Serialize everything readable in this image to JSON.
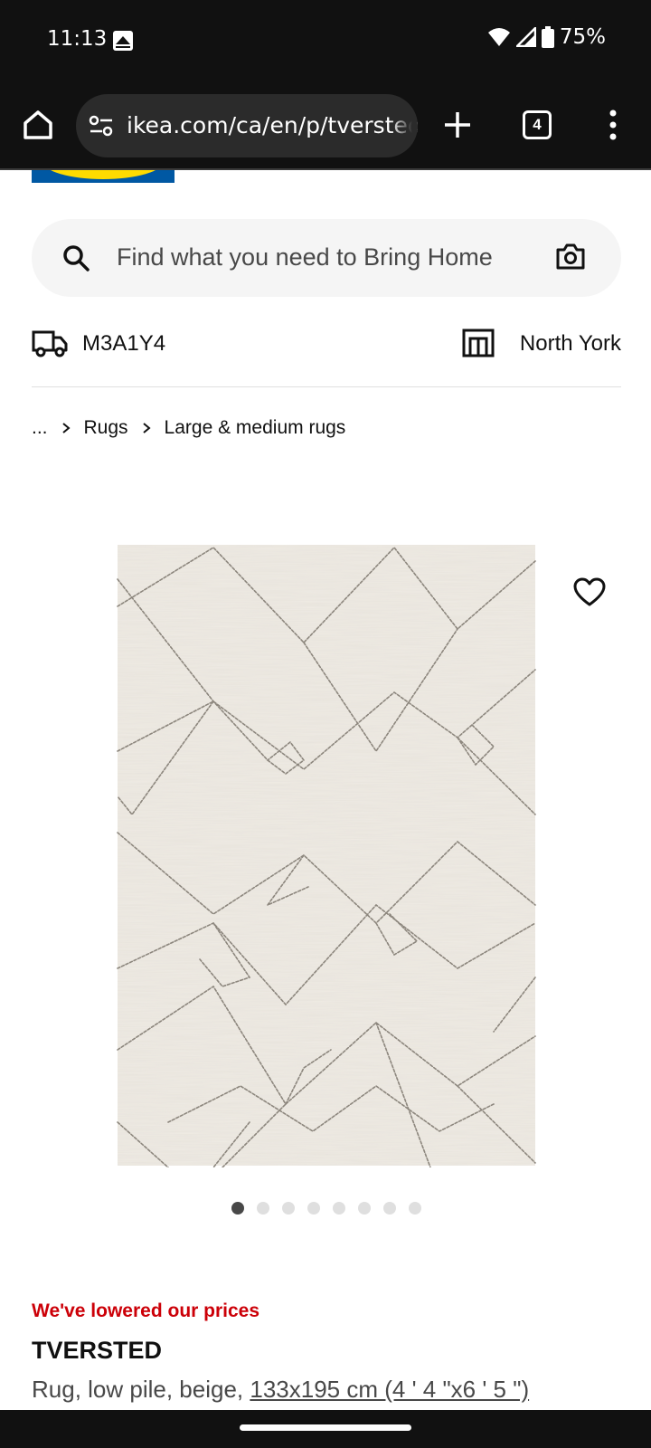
{
  "status_bar": {
    "time": "11:13",
    "battery": "75%",
    "icons": [
      "wifi-icon",
      "signal-icon",
      "battery-icon"
    ]
  },
  "browser": {
    "url": "ikea.com/ca/en/p/tversted",
    "tab_count": "4"
  },
  "search": {
    "placeholder": "Find what you need to Bring Home"
  },
  "delivery": {
    "postal_code": "M3A1Y4",
    "store": "North York"
  },
  "breadcrumb": {
    "ellipsis": "...",
    "items": [
      "Rugs",
      "Large & medium rugs"
    ]
  },
  "carousel": {
    "total": 8,
    "active_index": 0
  },
  "product": {
    "price_note": "We've lowered our prices",
    "name": "TVERSTED",
    "description": "Rug, low pile, beige, ",
    "size": "133x195 cm (4 ' 4 \"x6 ' 5 \")"
  },
  "colors": {
    "brand_blue": "#0058a3",
    "brand_yellow": "#ffdb00",
    "price_red": "#cc0008",
    "rug_beige": "#efebe4"
  }
}
